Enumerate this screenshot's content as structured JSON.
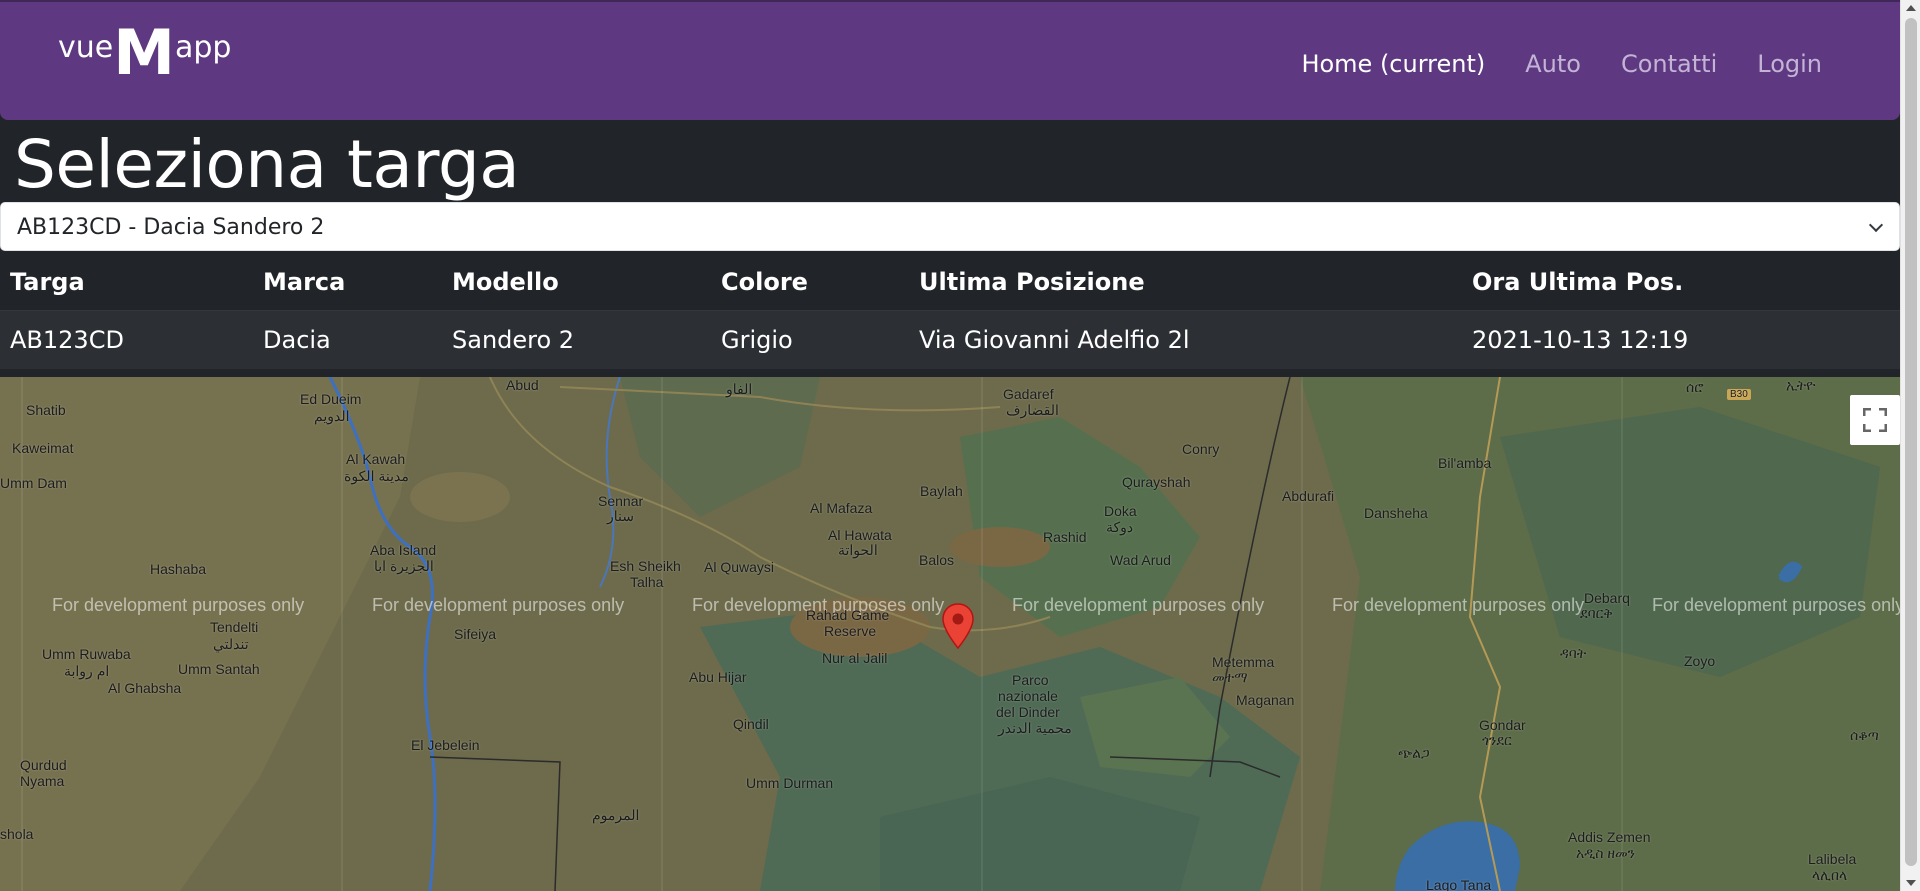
{
  "navbar": {
    "brand": {
      "prefix": "vue",
      "big": "M",
      "suffix": "app"
    },
    "items": [
      {
        "label": "Home (current)",
        "active": true
      },
      {
        "label": "Auto",
        "active": false
      },
      {
        "label": "Contatti",
        "active": false
      },
      {
        "label": "Login",
        "active": false
      }
    ],
    "background": "#5e3880"
  },
  "page": {
    "title": "Seleziona targa",
    "background": "#212529"
  },
  "plate_select": {
    "selected": "AB123CD - Dacia Sandero 2"
  },
  "table": {
    "headers": [
      "Targa",
      "Marca",
      "Modello",
      "Colore",
      "Ultima Posizione",
      "Ora Ultima Pos."
    ],
    "rows": [
      [
        "AB123CD",
        "Dacia",
        "Sandero 2",
        "Grigio",
        "Via Giovanni Adelfio 2l",
        "2021-10-13 12:19"
      ]
    ]
  },
  "map": {
    "watermark": "For development purposes only",
    "marker_color": "#ea4335",
    "places": {
      "p1": "Shatib",
      "p2": "Kaweimat",
      "p3": "Umm Dam",
      "p4": "Ed Dueim",
      "p5": "الدويم",
      "p6": "Abud",
      "p7": "الفاو",
      "p8": "Al Kawah",
      "p9": "مدينة الكوة",
      "p10": "Sennar",
      "p11": "سنار",
      "p12": "Aba Island",
      "p13": "الجزيرة ابا",
      "p14": "Hashaba",
      "p15": "Tendelti",
      "p16": "تندلتي",
      "p17": "Umm Ruwaba",
      "p18": "ام روابة",
      "p19": "Umm Santah",
      "p20": "Al Ghabsha",
      "p21": "Esh Sheikh",
      "p22": "Talha",
      "p23": "Al Quwaysi",
      "p24": "Sifeiya",
      "p25": "Abu Hijar",
      "p26": "Qindil",
      "p27": "Qurdud",
      "p28": "Nyama",
      "p29": "El Jebelein",
      "p30": "Umm Durman",
      "p31": "المرموم",
      "p32": "Al Mafaza",
      "p33": "Al Hawata",
      "p34": "الحواتة",
      "p35": "Baylah",
      "p36": "Balos",
      "p37": "Rahad Game",
      "p38": "Reserve",
      "p39": "Nur al Jalil",
      "p40": "Gadaref",
      "p41": "القضارف",
      "p42": "Conry",
      "p43": "Qurayshah",
      "p44": "Doka",
      "p45": "دوكة",
      "p46": "Rashid",
      "p47": "Wad Arud",
      "p48": "Parco",
      "p49": "nazionale",
      "p50": "del Dinder",
      "p51": "محمية الدندر",
      "p52": "Metemma",
      "p53": "መተማ",
      "p54": "Maganan",
      "p55": "Abdurafi",
      "p56": "Bil'amba",
      "p57": "Dansheha",
      "p58": "Debarq",
      "p59": "ደባርቅ",
      "p60": "Zoyo",
      "p61": "Gondar",
      "p62": "ጎንደር",
      "p63": "ጭልጋ",
      "p64": "Addis Zemen",
      "p65": "አዲስ ዘመን",
      "p66": "Lago Tana",
      "p67": "Lalibela",
      "p68": "ላሊበላ",
      "p69": "ሰቆጣ",
      "p70": "ዳባት",
      "p71": "ኢትዮ",
      "p72": "ሰሮ",
      "p73": "B30",
      "p74": "shola"
    }
  }
}
